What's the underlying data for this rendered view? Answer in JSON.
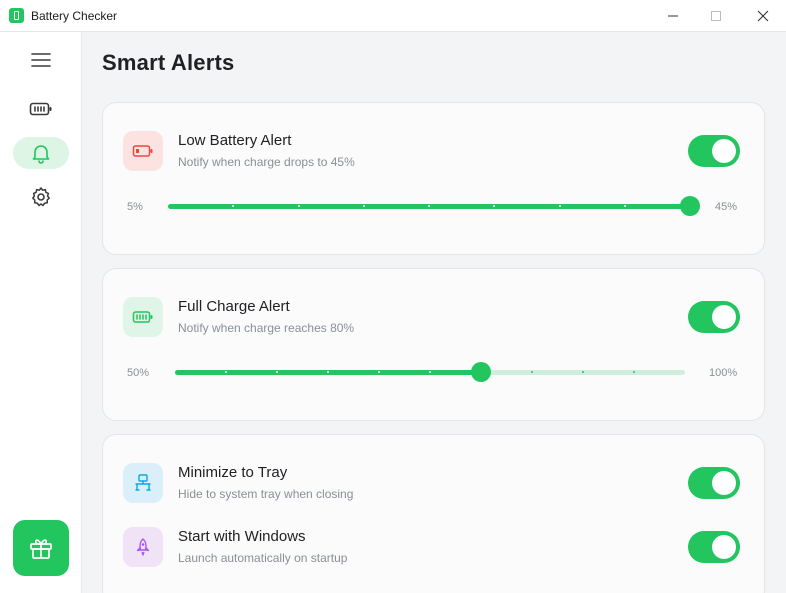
{
  "window": {
    "title": "Battery Checker"
  },
  "sidebar": {
    "items": [
      {
        "name": "menu",
        "icon": "hamburger-menu-icon"
      },
      {
        "name": "battery",
        "icon": "battery-icon"
      },
      {
        "name": "alerts",
        "icon": "bell-icon",
        "active": true
      },
      {
        "name": "settings",
        "icon": "gear-icon"
      }
    ],
    "gift_icon": "gift-icon"
  },
  "page": {
    "title": "Smart Alerts"
  },
  "low_battery": {
    "title": "Low Battery Alert",
    "subtitle": "Notify when charge drops to 45%",
    "enabled": true,
    "min_label": "5%",
    "max_label": "45%",
    "slider": {
      "min": 5,
      "max": 45,
      "value": 45,
      "step": 5
    }
  },
  "full_charge": {
    "title": "Full Charge Alert",
    "subtitle": "Notify when charge reaches 80%",
    "enabled": true,
    "min_label": "50%",
    "max_label": "100%",
    "slider": {
      "min": 50,
      "max": 100,
      "value": 80,
      "step": 5
    }
  },
  "tray": {
    "title": "Minimize to Tray",
    "subtitle": "Hide to system tray when closing",
    "enabled": true
  },
  "startup": {
    "title": "Start with Windows",
    "subtitle": "Launch automatically on startup",
    "enabled": true
  },
  "colors": {
    "accent": "#22c55e",
    "accent_light": "#dcf5e4",
    "red_tint": "#fde2e2",
    "green_tint": "#dff5e7",
    "blue_tint": "#dbeffa",
    "purple_tint": "#efe3f5"
  }
}
